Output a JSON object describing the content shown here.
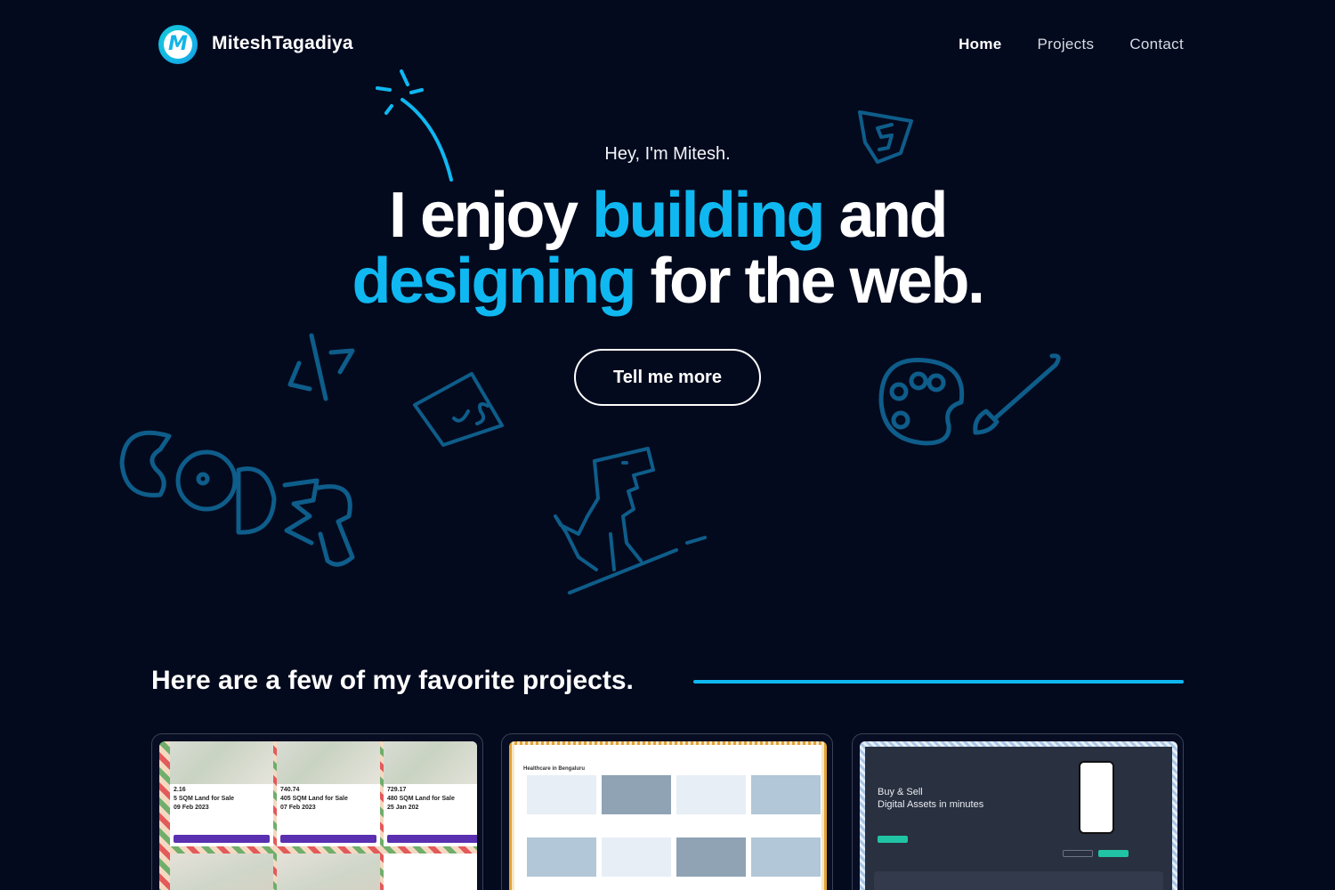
{
  "header": {
    "logo_letter": "M",
    "brand": "MiteshTagadiya",
    "nav": [
      {
        "label": "Home",
        "active": true
      },
      {
        "label": "Projects",
        "active": false
      },
      {
        "label": "Contact",
        "active": false
      }
    ]
  },
  "hero": {
    "greeting": "Hey, I'm Mitesh.",
    "title_part1": "I enjoy ",
    "title_accent1": "building",
    "title_part2": " and",
    "title_accent2": "designing",
    "title_part3": " for the web.",
    "cta_label": "Tell me more"
  },
  "doodles": {
    "color": "#0e5d8a",
    "accent": "#0fb8f1",
    "items": [
      "sparkle-line-icon",
      "html5-badge-icon",
      "code-tag-icon",
      "js-file-icon",
      "palette-icon",
      "paintbrush-icon",
      "coder-text-icon",
      "dino-skateboard-icon"
    ]
  },
  "projects": {
    "section_title": "Here are a few of my favorite projects.",
    "accent_color": "#0fb8f1",
    "cards": [
      {
        "name": "land-auction",
        "tiles": [
          {
            "price": "2.16",
            "title": "5 SQM Land for Sale",
            "date": "09 Feb 2023"
          },
          {
            "price": "740.74",
            "title": "405 SQM Land for Sale",
            "date": "07 Feb 2023"
          },
          {
            "price": "729.17",
            "title": "480 SQM Land for Sale",
            "date": "25 Jan 202"
          }
        ]
      },
      {
        "name": "healthcare-listing",
        "heading": "Healthcare in Bengaluru"
      },
      {
        "name": "digital-assets",
        "tagline_line1": "Buy & Sell",
        "tagline_line2": "Digital Assets in minutes"
      }
    ]
  }
}
